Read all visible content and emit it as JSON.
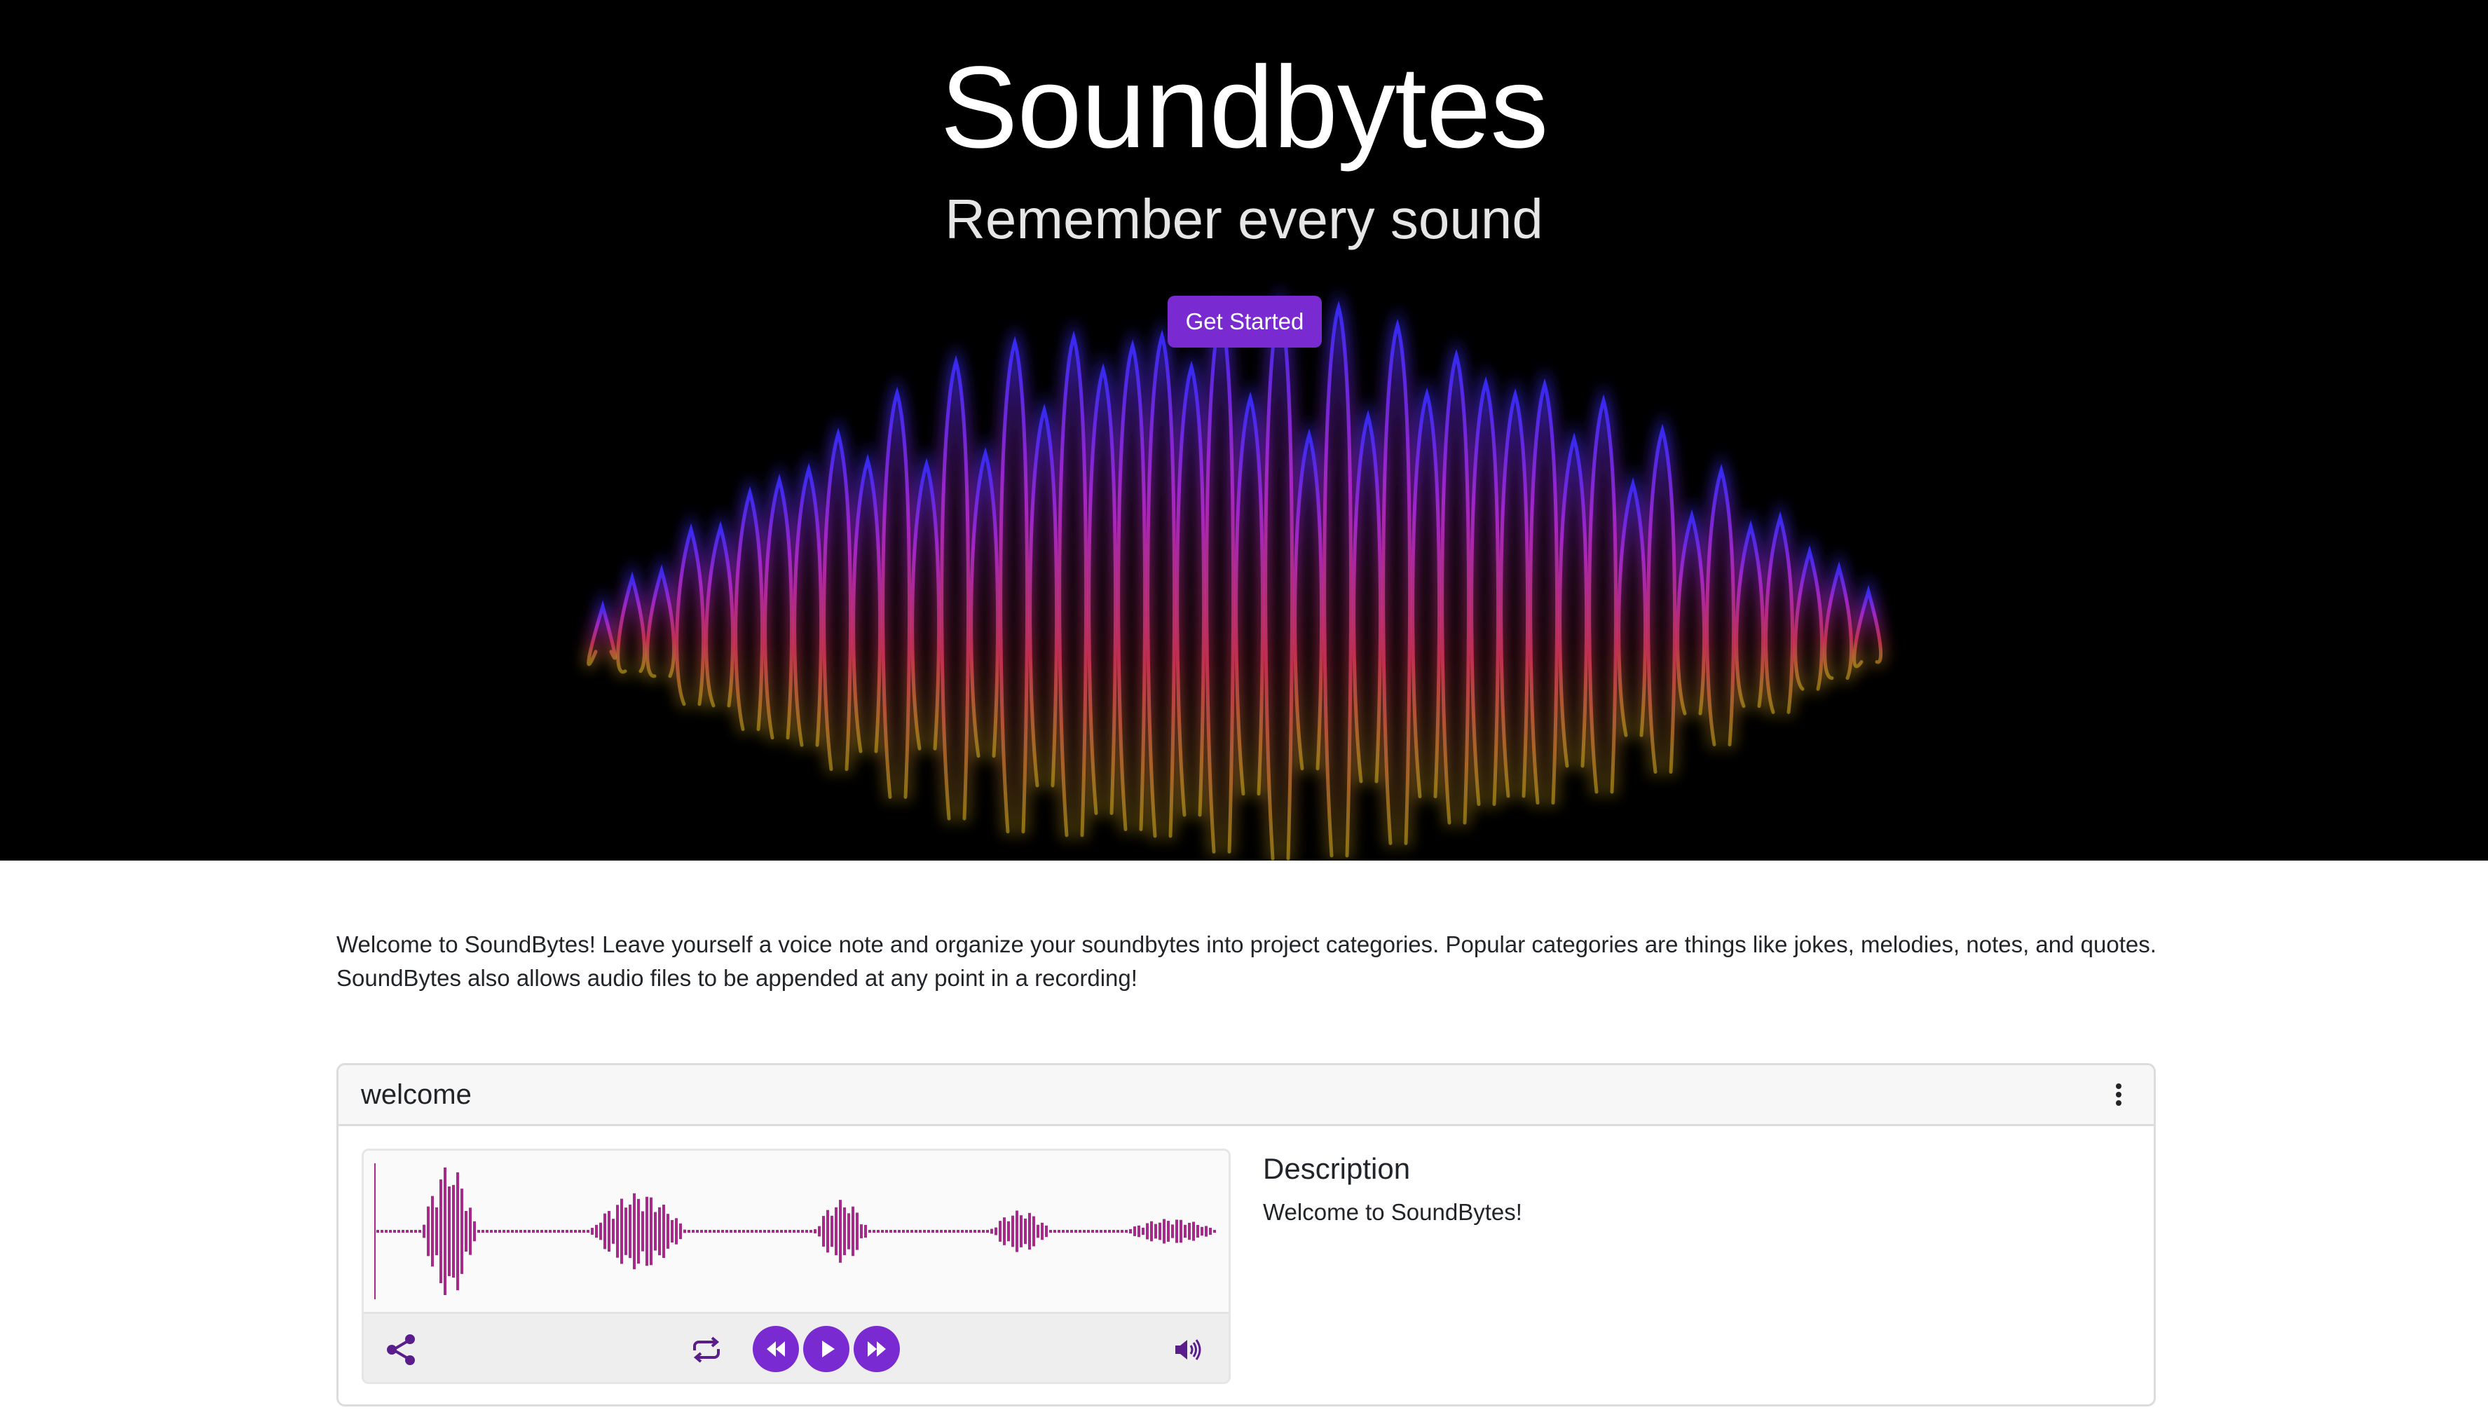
{
  "hero": {
    "title": "Soundbytes",
    "subtitle": "Remember every sound",
    "cta_label": "Get Started"
  },
  "intro": {
    "text": "Welcome to SoundBytes! Leave yourself a voice note and organize your soundbytes into project categories. Popular categories are things like jokes, melodies, notes, and quotes. SoundBytes also allows audio files to be appended at any point in a recording!"
  },
  "card": {
    "title": "welcome",
    "description_heading": "Description",
    "description_text": "Welcome to SoundBytes!"
  },
  "player": {
    "controls": [
      "share-icon",
      "repeat-icon",
      "rewind-icon",
      "play-icon",
      "fast-forward-icon",
      "volume-icon"
    ]
  },
  "colors": {
    "accent": "#7a2ad1",
    "waveform": "#a62a8a",
    "hero_background": "#000000"
  }
}
